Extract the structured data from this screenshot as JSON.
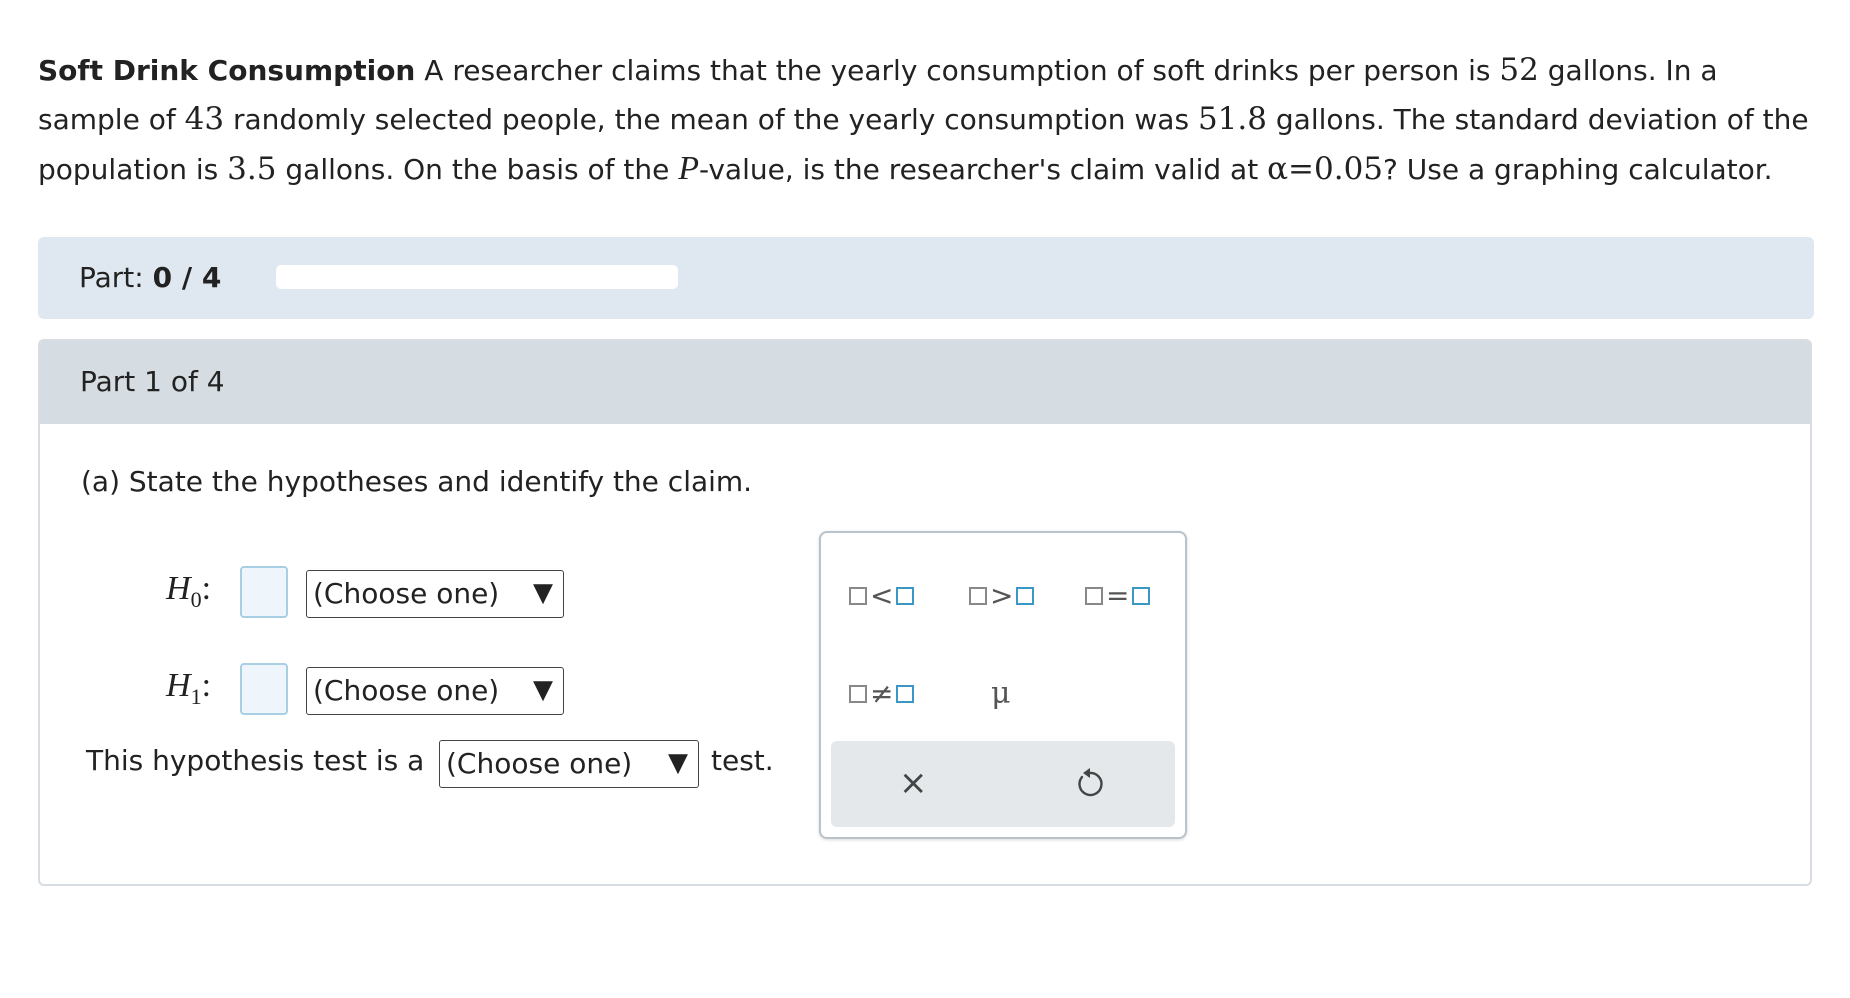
{
  "problem": {
    "title": "Soft Drink Consumption",
    "text_1": " A researcher claims that the yearly consumption of soft drinks per person is ",
    "claim_value": "52",
    "text_2": " gallons. In a sample of ",
    "sample_size": "43",
    "text_3": " randomly selected people, the mean of the yearly consumption was ",
    "sample_mean": "51.8",
    "text_4": " gallons. The standard deviation of the population is ",
    "population_sd": "3.5",
    "text_5": " gallons. On the basis of the ",
    "p_symbol": "P",
    "text_6": "-value, is the researcher's claim valid at ",
    "alpha_expr": "α=0.05",
    "text_7": "? Use a graphing calculator."
  },
  "progress": {
    "label": "Part:",
    "value": "0 / 4",
    "fraction": 0
  },
  "part": {
    "header": "Part 1 of 4",
    "question": "(a) State the hypotheses and identify the claim.",
    "h0": {
      "symbol": "H",
      "sub": "0",
      "colon": ":",
      "select": "(Choose one)"
    },
    "h1": {
      "symbol": "H",
      "sub": "1",
      "colon": ":",
      "select": "(Choose one)"
    },
    "test_pre": "This hypothesis test is a",
    "test_select": "(Choose one)",
    "test_post": "test.",
    "select_arrow": "▼"
  },
  "palette": {
    "lt": "<",
    "gt": ">",
    "eq": "=",
    "ne": "≠",
    "mu": "μ",
    "clear": "×",
    "icons": {
      "clear": "close-icon",
      "undo": "undo-icon"
    },
    "accent_color": "#3b98c4"
  }
}
